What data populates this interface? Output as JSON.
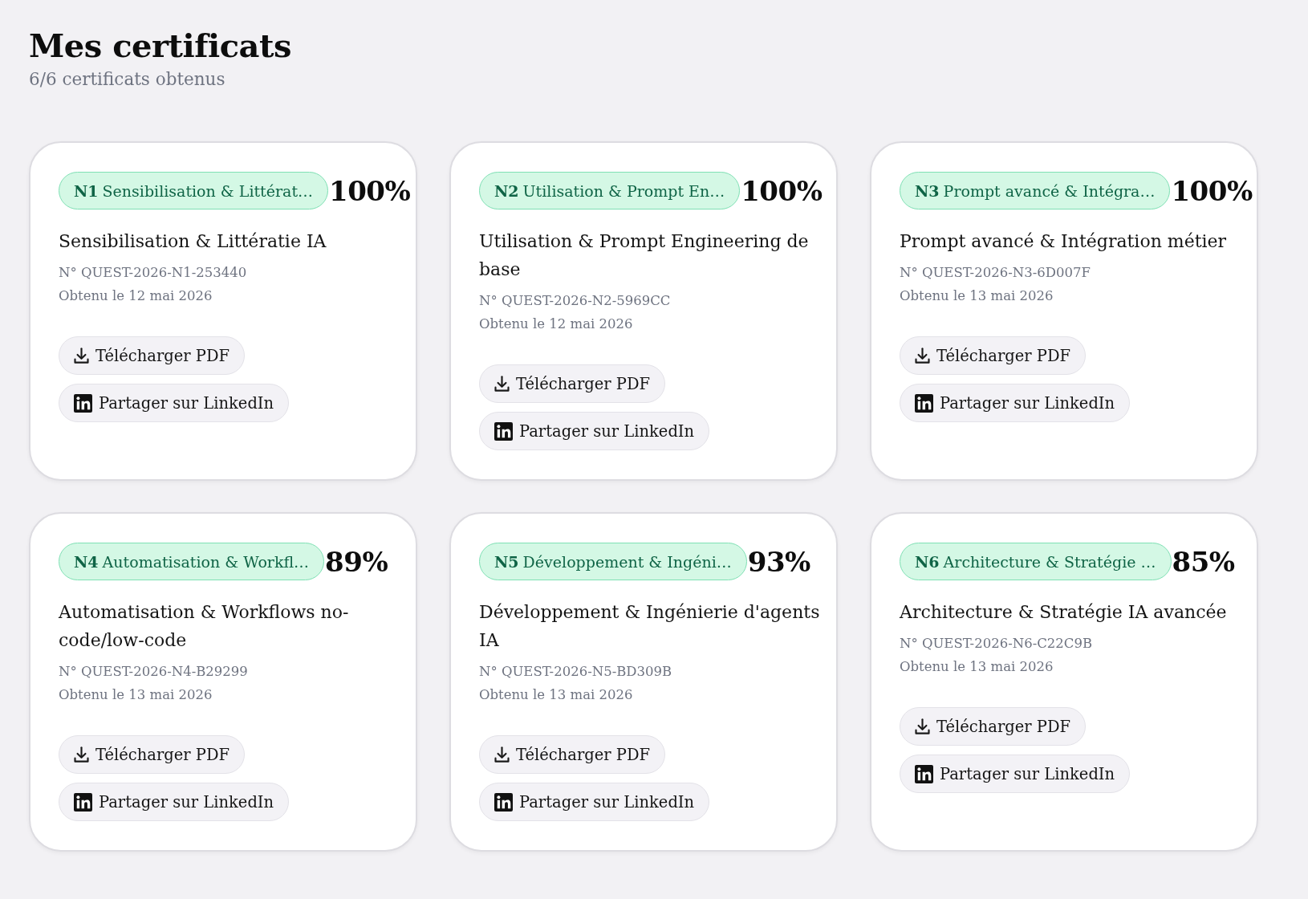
{
  "page": {
    "title": "Mes certificats",
    "subtitle": "6/6 certificats obtenus"
  },
  "certificates": [
    {
      "level_code": "N1",
      "level_name": "Sensibilisation & Littérat…",
      "score": "100%",
      "title": "Sensibilisation & Littératie IA",
      "number": "N° QUEST-2026-N1-253440",
      "date": "Obtenu le 12 mai 2026",
      "actions": [
        {
          "kind": "download",
          "label": "Télécharger PDF"
        },
        {
          "kind": "linkedin",
          "label": "Partager sur LinkedIn"
        }
      ]
    },
    {
      "level_code": "N2",
      "level_name": "Utilisation & Prompt En…",
      "score": "100%",
      "title": "Utilisation & Prompt Engineering de base",
      "number": "N° QUEST-2026-N2-5969CC",
      "date": "Obtenu le 12 mai 2026",
      "actions": [
        {
          "kind": "download",
          "label": "Télécharger PDF"
        },
        {
          "kind": "linkedin",
          "label": "Partager sur LinkedIn"
        }
      ]
    },
    {
      "level_code": "N3",
      "level_name": "Prompt avancé & Intégra…",
      "score": "100%",
      "title": "Prompt avancé & Intégration métier",
      "number": "N° QUEST-2026-N3-6D007F",
      "date": "Obtenu le 13 mai 2026",
      "actions": [
        {
          "kind": "download",
          "label": "Télécharger PDF"
        },
        {
          "kind": "linkedin",
          "label": "Partager sur LinkedIn"
        }
      ]
    },
    {
      "level_code": "N4",
      "level_name": "Automatisation & Workfl…",
      "score": "89%",
      "title": "Automatisation & Workflows no-code/low-code",
      "number": "N° QUEST-2026-N4-B29299",
      "date": "Obtenu le 13 mai 2026",
      "actions": [
        {
          "kind": "download",
          "label": "Télécharger PDF"
        },
        {
          "kind": "linkedin",
          "label": "Partager sur LinkedIn"
        }
      ]
    },
    {
      "level_code": "N5",
      "level_name": "Développement & Ingéni…",
      "score": "93%",
      "title": "Développement & Ingénierie d'agents IA",
      "number": "N° QUEST-2026-N5-BD309B",
      "date": "Obtenu le 13 mai 2026",
      "actions": [
        {
          "kind": "download",
          "label": "Télécharger PDF"
        },
        {
          "kind": "linkedin",
          "label": "Partager sur LinkedIn"
        }
      ]
    },
    {
      "level_code": "N6",
      "level_name": "Architecture & Stratégie …",
      "score": "85%",
      "title": "Architecture & Stratégie IA avancée",
      "number": "N° QUEST-2026-N6-C22C9B",
      "date": "Obtenu le 13 mai 2026",
      "actions": [
        {
          "kind": "download",
          "label": "Télécharger PDF"
        },
        {
          "kind": "linkedin",
          "label": "Partager sur LinkedIn"
        }
      ]
    }
  ]
}
